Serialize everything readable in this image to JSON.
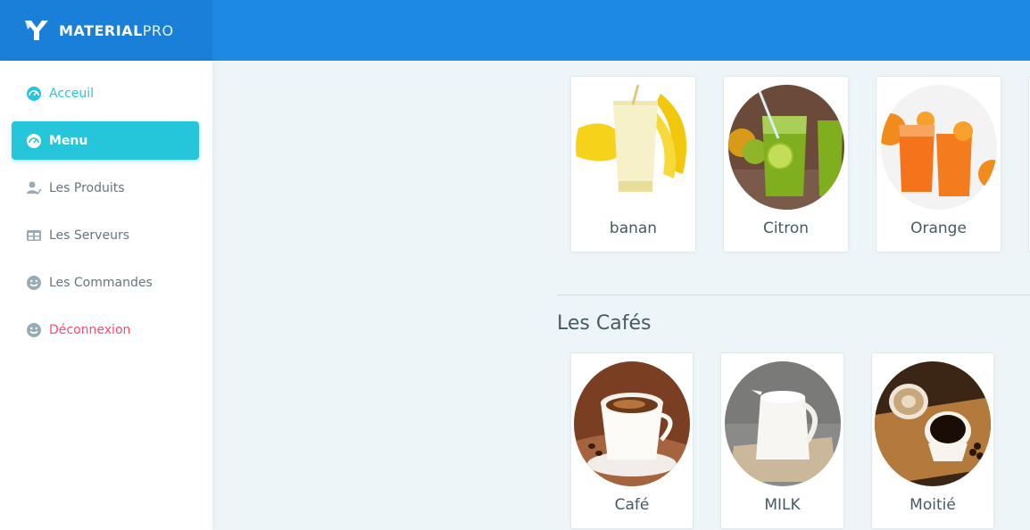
{
  "brand": {
    "bold": "MATERIAL",
    "light": "PRO"
  },
  "sidebar": {
    "items": [
      {
        "label": "Acceuil",
        "icon": "gauge-icon",
        "state": "teal"
      },
      {
        "label": "Menu",
        "icon": "gauge-icon",
        "state": "active"
      },
      {
        "label": "Les Produits",
        "icon": "user-check-icon",
        "state": "normal"
      },
      {
        "label": "Les Serveurs",
        "icon": "table-icon",
        "state": "normal"
      },
      {
        "label": "Les Commandes",
        "icon": "smiley-icon",
        "state": "normal"
      },
      {
        "label": "Déconnexion",
        "icon": "smiley-icon",
        "state": "red"
      }
    ]
  },
  "juices": {
    "items": [
      {
        "label": "banan",
        "icon": "banana-smoothie-image"
      },
      {
        "label": "Citron",
        "icon": "lemonade-image"
      },
      {
        "label": "Orange",
        "icon": "orange-juice-image"
      }
    ]
  },
  "cafes": {
    "title": "Les Cafés",
    "items": [
      {
        "label": "Café",
        "icon": "espresso-cup-image"
      },
      {
        "label": "MILK",
        "icon": "milk-jug-image"
      },
      {
        "label": "Moitié",
        "icon": "coffee-cups-image"
      }
    ]
  },
  "colors": {
    "header": "#1e88e5",
    "active": "#26c6da",
    "danger": "#fc4b6c"
  }
}
